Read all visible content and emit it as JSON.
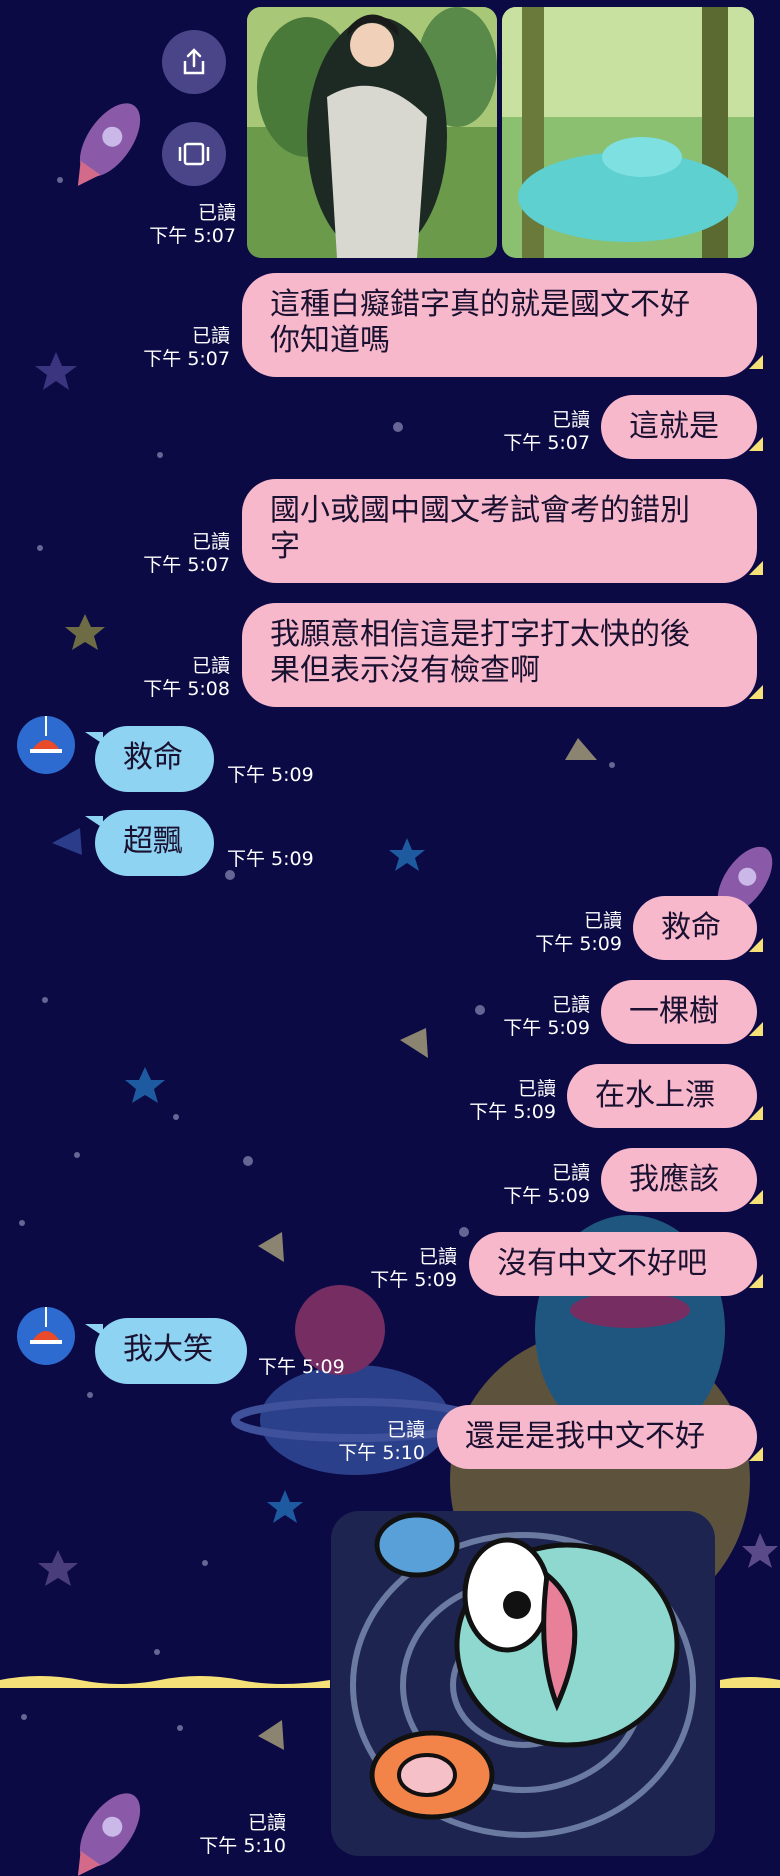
{
  "sidebar_actions": [
    {
      "icon": "share-icon"
    },
    {
      "icon": "fullscreen-icon"
    }
  ],
  "photos": [
    {
      "alt": "character-illustration"
    },
    {
      "alt": "forest-river-illustration"
    }
  ],
  "photo_meta": {
    "read": "已讀",
    "time": "下午 5:07"
  },
  "messages": [
    {
      "side": "me",
      "lines": [
        "這種白癡錯字真的就是國文不好",
        "你知道嗎"
      ],
      "read": "已讀",
      "time": "下午 5:07"
    },
    {
      "side": "me",
      "lines": [
        "這就是"
      ],
      "read": "已讀",
      "time": "下午 5:07"
    },
    {
      "side": "me",
      "lines": [
        "國小或國中國文考試會考的錯別",
        "字"
      ],
      "read": "已讀",
      "time": "下午 5:07"
    },
    {
      "side": "me",
      "lines": [
        "我願意相信這是打字打太快的後",
        "果但表示沒有檢查啊"
      ],
      "read": "已讀",
      "time": "下午 5:08"
    },
    {
      "side": "them",
      "lines": [
        "救命"
      ],
      "time": "下午 5:09"
    },
    {
      "side": "them",
      "lines": [
        "超飄"
      ],
      "time": "下午 5:09"
    },
    {
      "side": "me",
      "lines": [
        "救命"
      ],
      "read": "已讀",
      "time": "下午 5:09"
    },
    {
      "side": "me",
      "lines": [
        "一棵樹"
      ],
      "read": "已讀",
      "time": "下午 5:09"
    },
    {
      "side": "me",
      "lines": [
        "在水上漂"
      ],
      "read": "已讀",
      "time": "下午 5:09"
    },
    {
      "side": "me",
      "lines": [
        "我應該"
      ],
      "read": "已讀",
      "time": "下午 5:09"
    },
    {
      "side": "me",
      "lines": [
        "沒有中文不好吧"
      ],
      "read": "已讀",
      "time": "下午 5:09"
    },
    {
      "side": "them",
      "lines": [
        "我大笑"
      ],
      "time": "下午 5:09"
    },
    {
      "side": "me",
      "lines": [
        "還是是我中文不好"
      ],
      "read": "已讀",
      "time": "下午 5:10"
    }
  ],
  "sticker": {
    "name": "fish-monster-sticker",
    "read": "已讀",
    "time": "下午 5:10"
  },
  "colors": {
    "background": "#0b0a45",
    "my_bubble": "#f7b8cc",
    "their_bubble": "#8fd3f2",
    "meta_text": "#ffffff"
  }
}
